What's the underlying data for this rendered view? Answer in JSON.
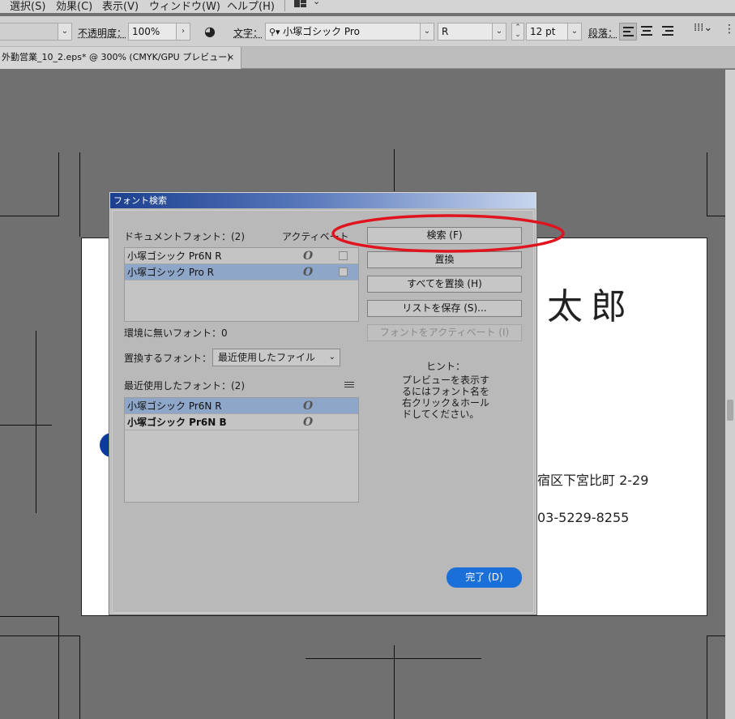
{
  "menubar": {
    "items": [
      "選択(S)",
      "効果(C)",
      "表示(V)",
      "ウィンドウ(W)",
      "ヘルプ(H)"
    ],
    "workspace_icon": "workspace-grid-icon"
  },
  "control_bar": {
    "opacity_label": "不透明度：",
    "opacity_value": "100%",
    "font_label": "文字：",
    "font_name": "小塚ゴシック Pro",
    "font_style": "R",
    "font_size": "12 pt",
    "paragraph_label": "段落："
  },
  "document_tab": {
    "title": "外勤営業_10_2.eps* @ 300% (CMYK/GPU プレビュー)",
    "close": "×"
  },
  "artboard": {
    "name_text": "太郎",
    "address_text": "宿区下宮比町 2-29",
    "phone_text": "03-5229-8255"
  },
  "dialog": {
    "title": "フォント検索",
    "document_fonts_label": "ドキュメントフォント：(2)",
    "activate_label": "アクティベート",
    "document_fonts": [
      {
        "name": "小塚ゴシック Pr6N R",
        "selected": false
      },
      {
        "name": "小塚ゴシック Pro R",
        "selected": true
      }
    ],
    "missing_fonts_label": "環境に無いフォント：0",
    "replace_with_label": "置換するフォント：",
    "replace_with_value": "最近使用したファイル",
    "recent_fonts_label": "最近使用したフォント：(2)",
    "recent_fonts": [
      {
        "name": "小塚ゴシック Pr6N R",
        "selected": true
      },
      {
        "name": "小塚ゴシック Pr6N B",
        "selected": false
      }
    ],
    "buttons": {
      "find": "検索 (F)",
      "replace": "置換",
      "replace_all": "すべてを置換 (H)",
      "save_list": "リストを保存 (S)...",
      "activate_fonts": "フォントをアクティベート (I)"
    },
    "hint_title": "ヒント：",
    "hint_body": "プレビューを表示するにはフォント名を右クリック＆ホールドしてください。",
    "done": "完了 (D)",
    "font_type_icon": "O"
  },
  "colors": {
    "annotation": "#e0141e",
    "done_button": "#1b6fd8",
    "selection": "#8ea6c8"
  }
}
